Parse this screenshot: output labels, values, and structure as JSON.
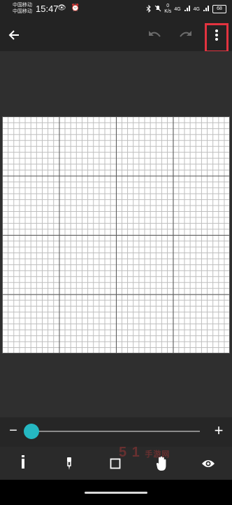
{
  "status_bar": {
    "carrier_1": "中国移动",
    "carrier_2": "中国移动",
    "time": "15:47",
    "left_icons": "👁 ⏰",
    "speed_value": "0",
    "speed_unit": "K/s",
    "network_1": "4G",
    "network_2": "4G",
    "battery": "68"
  },
  "toolbar": {
    "back_icon": "arrow-left",
    "undo_icon": "undo",
    "redo_icon": "redo",
    "more_icon": "three-dots-vertical"
  },
  "zoom": {
    "minus_label": "−",
    "plus_label": "+",
    "value_fraction": 0.02
  },
  "tools": [
    {
      "name": "pencil",
      "active": true
    },
    {
      "name": "eyedropper",
      "active": false
    },
    {
      "name": "square",
      "active": false
    },
    {
      "name": "hand",
      "active": false
    },
    {
      "name": "eye",
      "active": false
    }
  ],
  "watermark": {
    "text": "5 1",
    "sub": "手游网"
  },
  "colors": {
    "accent": "#25b7c1",
    "annotation": "#e2333f",
    "background": "#2e2e2e"
  }
}
